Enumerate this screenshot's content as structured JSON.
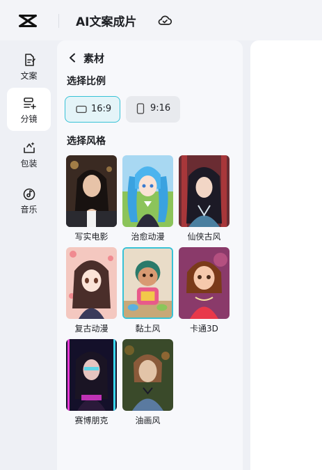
{
  "app": {
    "title": "AI文案成片"
  },
  "nav": {
    "items": [
      {
        "label": "文案",
        "icon": "script-icon"
      },
      {
        "label": "分镜",
        "icon": "storyboard-icon"
      },
      {
        "label": "包装",
        "icon": "packaging-icon"
      },
      {
        "label": "音乐",
        "icon": "music-icon"
      }
    ],
    "active_index": 1
  },
  "panel": {
    "back_label": "素材",
    "ratio_title": "选择比例",
    "ratios": [
      {
        "label": "16:9",
        "selected": true
      },
      {
        "label": "9:16",
        "selected": false
      }
    ],
    "style_title": "选择风格",
    "styles": [
      {
        "label": "写实电影"
      },
      {
        "label": "治愈动漫"
      },
      {
        "label": "仙侠古风"
      },
      {
        "label": "复古动漫"
      },
      {
        "label": "黏土风"
      },
      {
        "label": "卡通3D"
      },
      {
        "label": "赛博朋克"
      },
      {
        "label": "油画风"
      }
    ],
    "selected_style_index": 4
  },
  "colors": {
    "accent": "#37c2d6",
    "panel_bg": "#f7f8fb",
    "page_bg": "#eef0f5"
  }
}
